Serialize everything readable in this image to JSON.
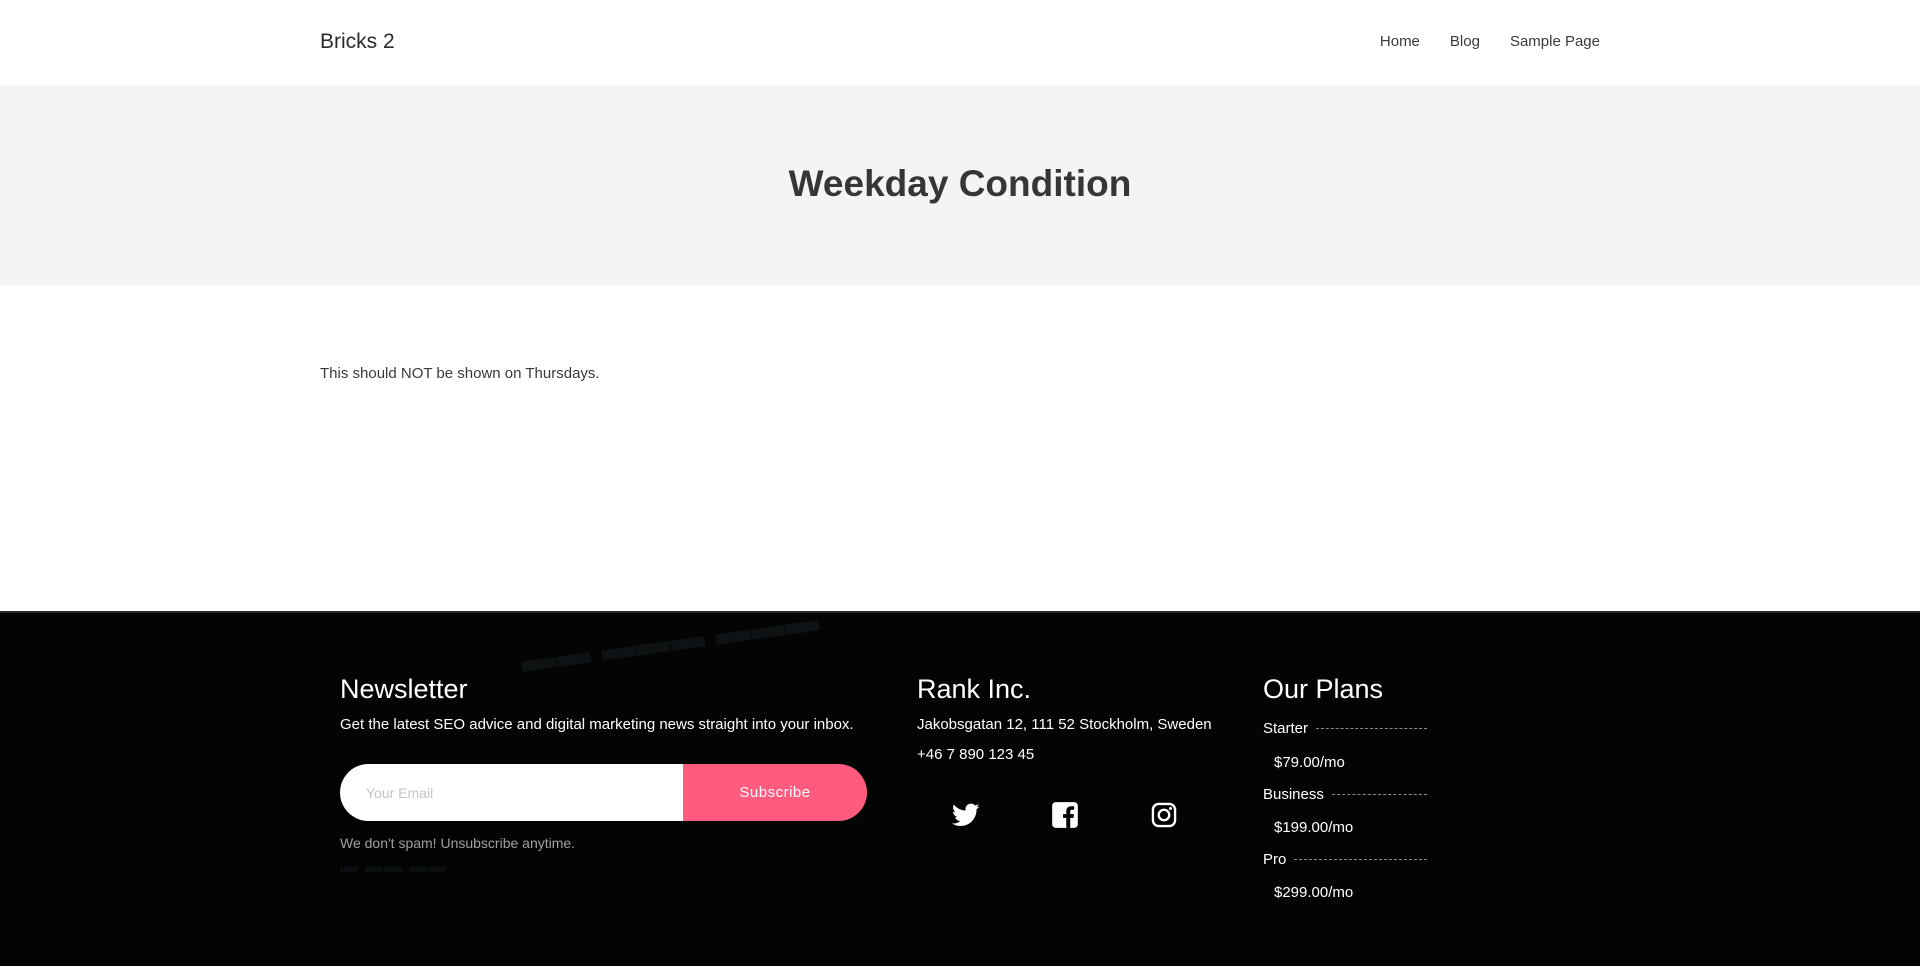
{
  "header": {
    "brand": "Bricks 2",
    "nav": [
      "Home",
      "Blog",
      "Sample Page"
    ]
  },
  "hero": {
    "title": "Weekday Condition"
  },
  "content": {
    "text": "This should NOT be shown on Thursdays."
  },
  "footer": {
    "newsletter": {
      "title": "Newsletter",
      "description": "Get the latest SEO advice and digital marketing news straight into your inbox.",
      "email_placeholder": "Your Email",
      "subscribe_label": "Subscribe",
      "note": "We don't spam! Unsubscribe anytime."
    },
    "company": {
      "title": "Rank Inc.",
      "address": "Jakobsgatan 12, 111 52 Stockholm, Sweden",
      "phone": "+46 7 890 123 45",
      "social_icons": [
        "twitter-icon",
        "facebook-icon",
        "instagram-icon"
      ]
    },
    "plans": {
      "title": "Our Plans",
      "items": [
        {
          "name": "Starter",
          "price": "$79.00/mo"
        },
        {
          "name": "Business",
          "price": "$199.00/mo"
        },
        {
          "name": "Pro",
          "price": "$299.00/mo"
        }
      ]
    }
  },
  "colors": {
    "accent": "#ff5b7e",
    "footer_bg": "#030404",
    "hero_bg": "#f4f4f4"
  }
}
